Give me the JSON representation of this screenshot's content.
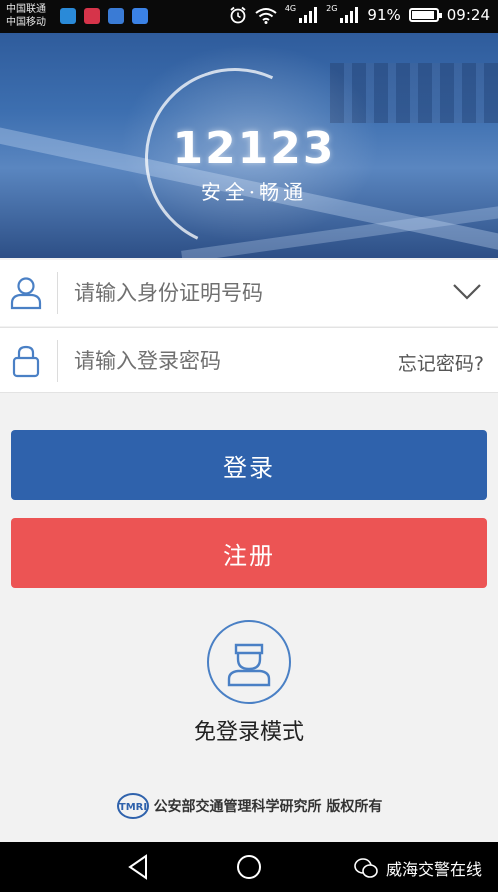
{
  "status_bar": {
    "carrier_1": "中国联通",
    "carrier_2": "中国移动",
    "network_1": "4G",
    "network_2": "2G",
    "battery": "91%",
    "time": "09:24"
  },
  "banner": {
    "brand_number": "12123",
    "slogan": "安全·畅通"
  },
  "form": {
    "id_field": {
      "placeholder": "请输入身份证明号码",
      "value": ""
    },
    "password_field": {
      "placeholder": "请输入登录密码",
      "value": ""
    },
    "forgot_password_label": "忘记密码?"
  },
  "actions": {
    "login_label": "登录",
    "register_label": "注册",
    "guest_mode_label": "免登录模式"
  },
  "footer": {
    "logo_text": "TMRI",
    "copyright": "公安部交通管理科学研究所 版权所有"
  },
  "watermark": {
    "text": "威海交警在线"
  },
  "colors": {
    "login_button": "#2f62ac",
    "register_button": "#ec5454",
    "icon_blue": "#4a80c5"
  }
}
